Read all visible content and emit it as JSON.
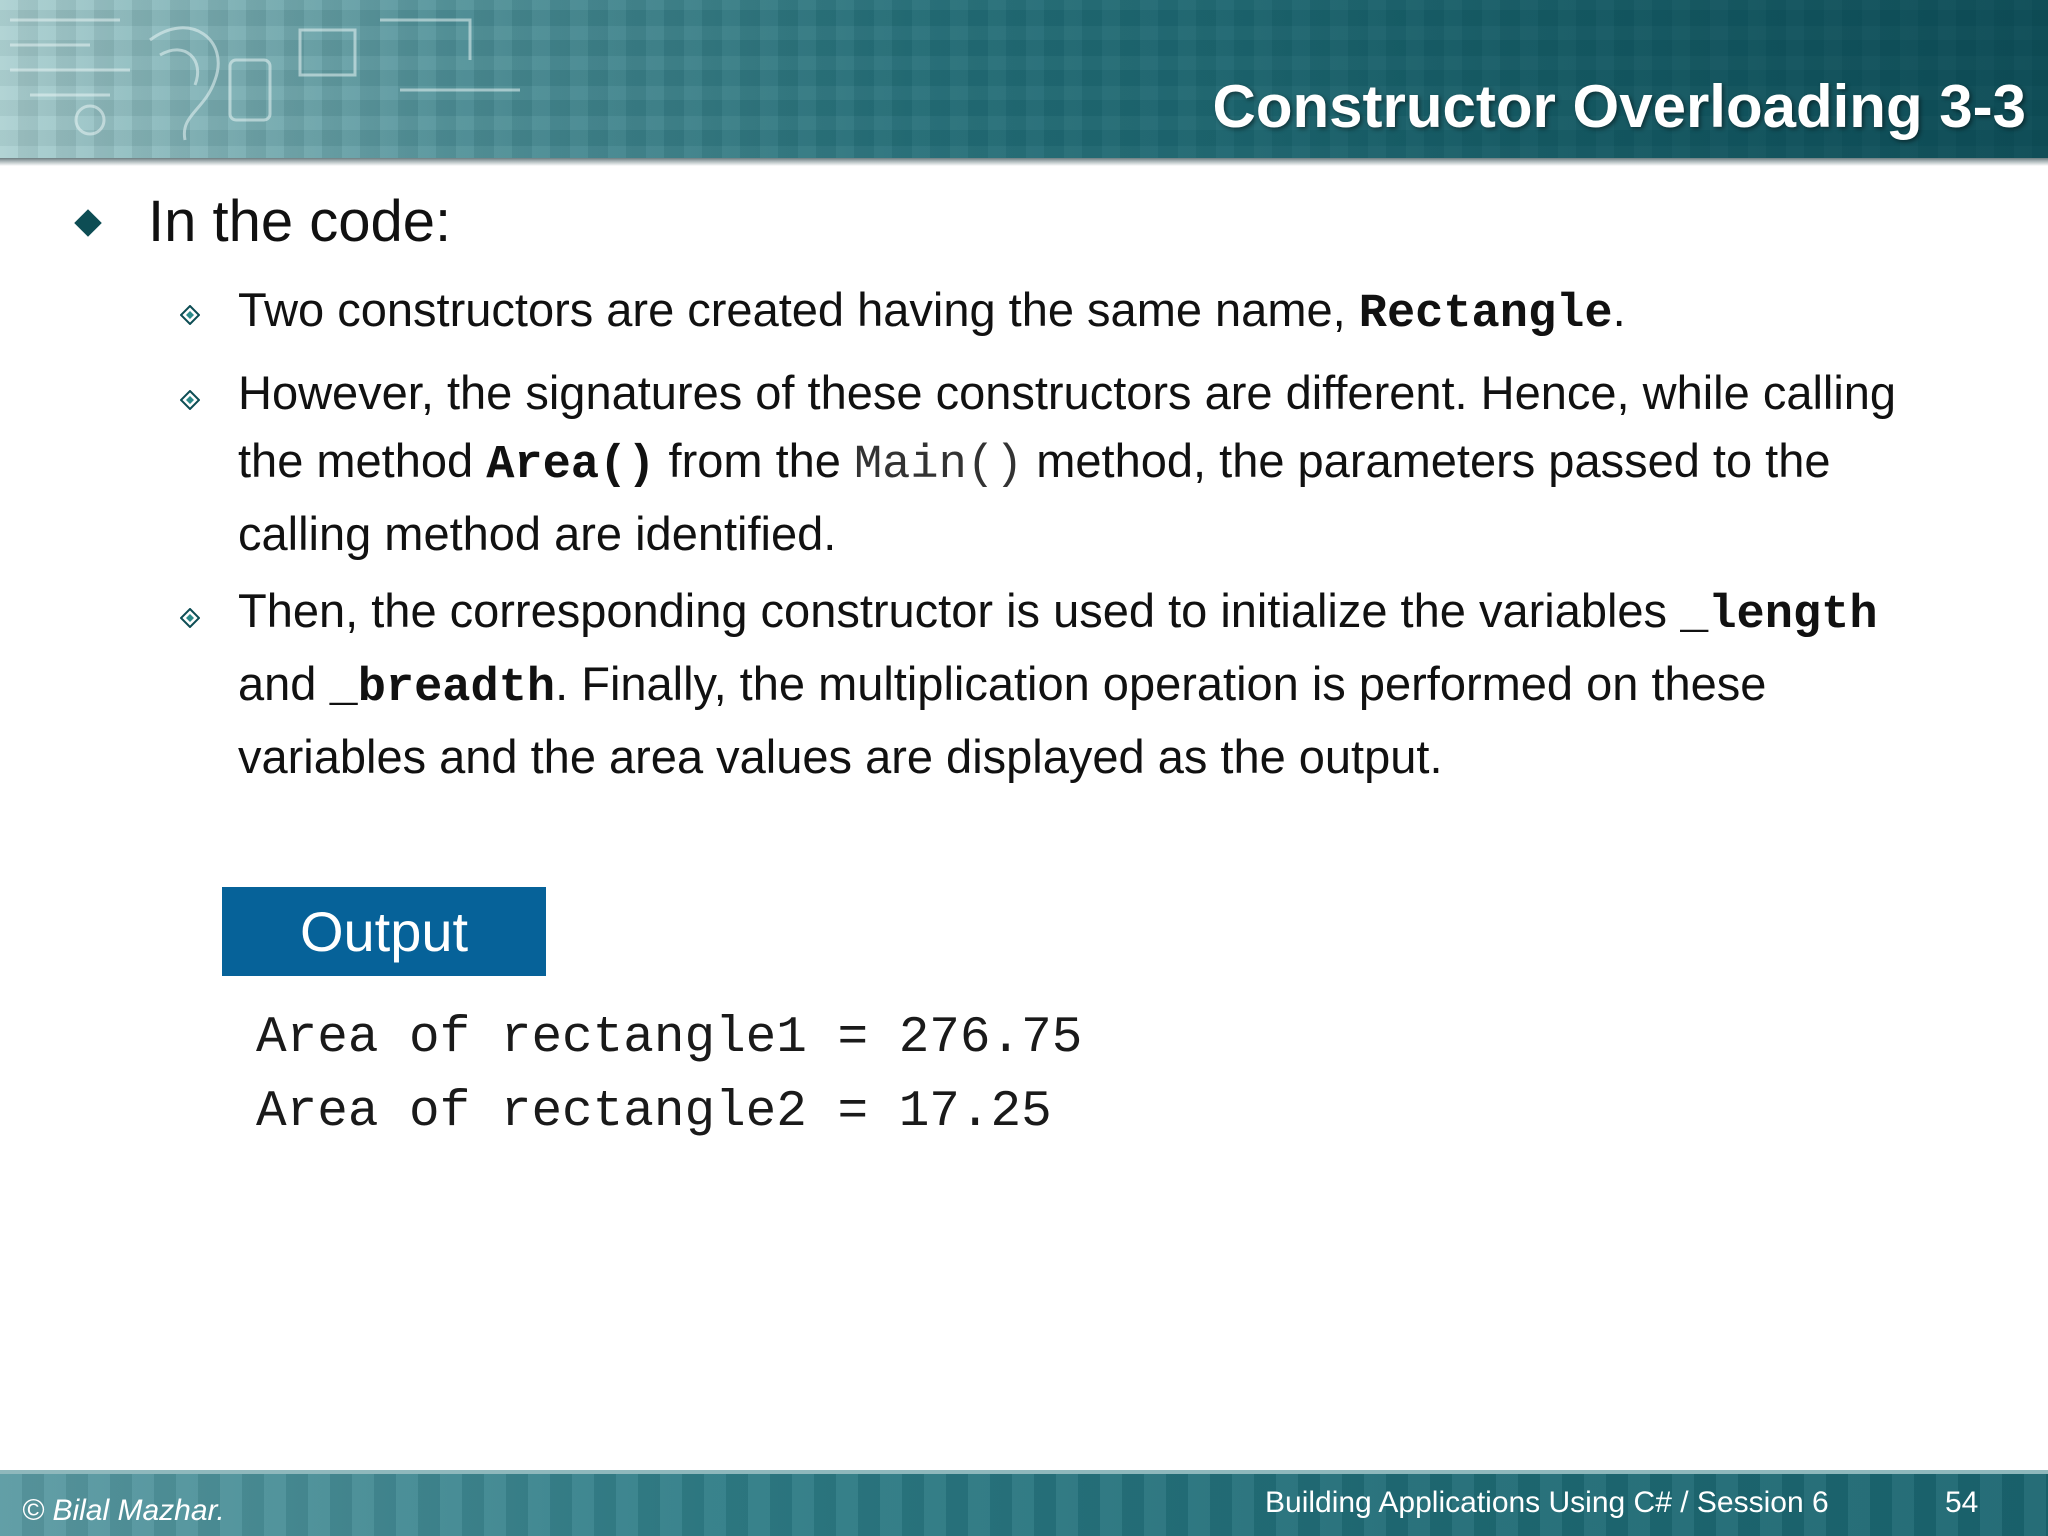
{
  "header": {
    "title": "Constructor Overloading 3-3"
  },
  "content": {
    "main_bullet": "In the code:",
    "sub1": {
      "text_a": "Two constructors are created having the same name, ",
      "code": "Rectangle",
      "text_b": "."
    },
    "sub2": {
      "text_a": "However, the signatures of these constructors are different. Hence, while calling the method ",
      "code_area": "Area()",
      "text_b": " from the ",
      "code_main": "Main()",
      "text_c": "  method, the parameters passed to the calling method are identified."
    },
    "sub3": {
      "text_a": "Then, the corresponding constructor is used to initialize the variables ",
      "code_length": "_length",
      "text_b": "  and ",
      "code_breadth": "_breadth",
      "text_c": ". Finally, the multiplication operation is performed on these variables and the area values are displayed as the output."
    }
  },
  "output": {
    "label": "Output",
    "lines": [
      "Area of rectangle1 = 276.75",
      "Area of rectangle2 = 17.25"
    ]
  },
  "footer": {
    "copyright": "© Bilal Mazhar.",
    "course": "Building Applications Using C# / Session 6",
    "page_number": "54"
  },
  "colors": {
    "banner": "#1d6a74",
    "output_label_bg": "#066299",
    "bullet": "#0d4d54"
  },
  "icons": {
    "main_bullet": "diamond-bullet-icon",
    "sub_bullet": "outlined-diamond-bullet-icon"
  }
}
